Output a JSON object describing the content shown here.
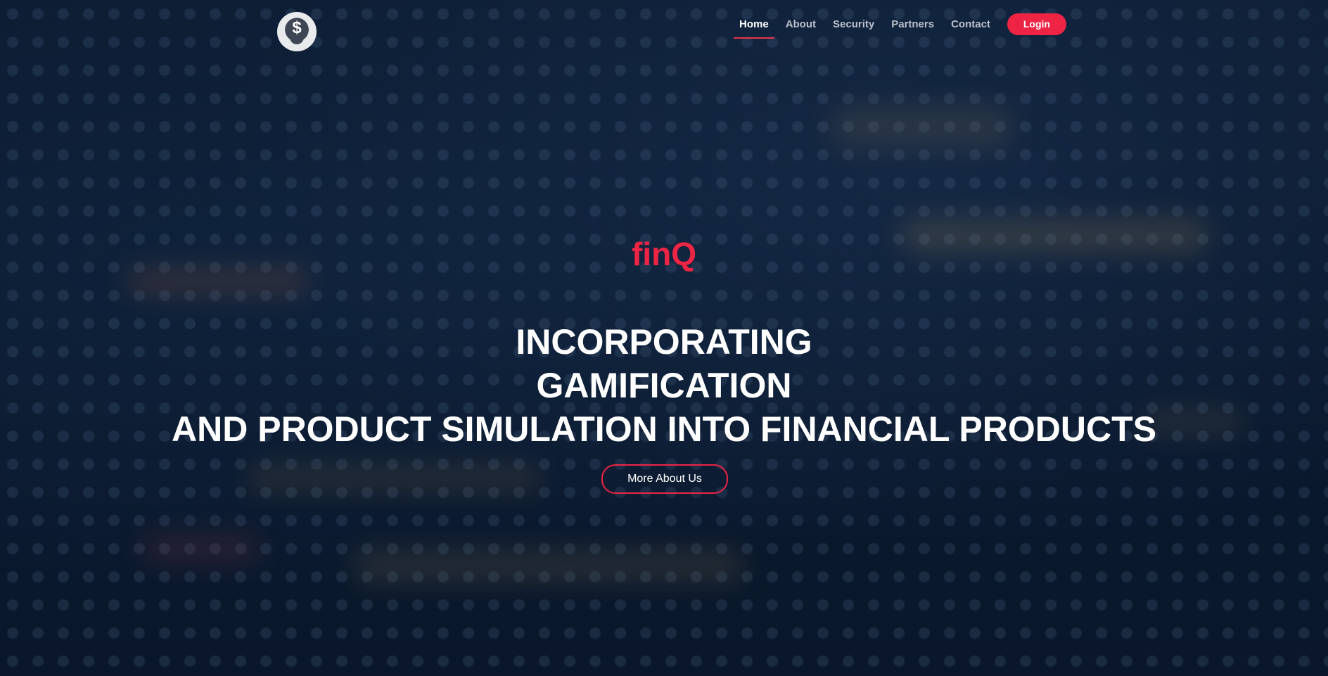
{
  "header": {
    "logo_icon": "dollar-plant-icon",
    "nav": {
      "items": [
        {
          "label": "Home",
          "active": true
        },
        {
          "label": "About"
        },
        {
          "label": "Security"
        },
        {
          "label": "Partners"
        },
        {
          "label": "Contact"
        }
      ],
      "login_label": "Login"
    }
  },
  "hero": {
    "brand": "finQ",
    "headline_lines": [
      "INCORPORATING",
      "GAMIFICATION",
      "AND PRODUCT SIMULATION INTO FINANCIAL PRODUCTS"
    ],
    "cta_label": "More About Us"
  },
  "colors": {
    "accent": "#ee2445",
    "text_primary": "#ffffff",
    "text_muted": "#b9c0cb",
    "background": "#0b1a30"
  }
}
